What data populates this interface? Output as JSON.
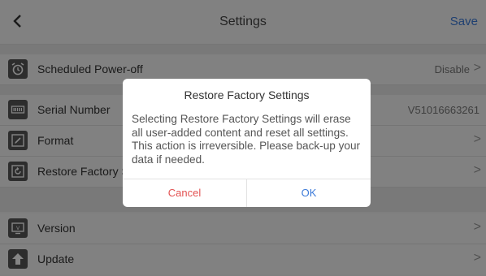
{
  "header": {
    "back_icon": "chevron-left-icon",
    "title": "Settings",
    "save_label": "Save"
  },
  "settings": {
    "scheduled_power_off": {
      "label": "Scheduled Power-off",
      "value": "Disable",
      "icon": "alarm-clock-icon"
    },
    "serial_number": {
      "label": "Serial Number",
      "value": "V51016663261",
      "icon": "barcode-icon"
    },
    "format": {
      "label": "Format",
      "icon": "format-icon"
    },
    "restore_factory": {
      "label": "Restore Factory S",
      "icon": "restore-icon"
    },
    "version": {
      "label": "Version",
      "icon": "version-icon"
    },
    "update": {
      "label": "Update",
      "icon": "upload-arrow-icon"
    }
  },
  "dialog": {
    "title": "Restore Factory Settings",
    "message": "Selecting Restore Factory Settings will erase all user-added content and reset all settings. This action is irreversible. Please back-up your data if needed.",
    "cancel_label": "Cancel",
    "ok_label": "OK"
  },
  "colors": {
    "accent": "#3d7bd9",
    "danger": "#e35252"
  },
  "chevron": ">"
}
